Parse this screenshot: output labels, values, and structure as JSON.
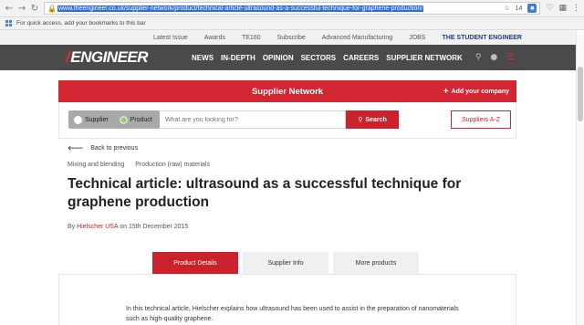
{
  "browser": {
    "url": "www.theengineer.co.uk/supplier-network/product/technical-article-ultrasound-as-a-successful-technique-for-graphene-production/",
    "ext_count": "14",
    "bookmarks_hint": "For quick access, add your bookmarks to this bar"
  },
  "site_util": {
    "links": [
      "Latest Issue",
      "Awards",
      "TE160",
      "Subscribe",
      "Advanced Manufacturing",
      "JOBS",
      "THE STUDENT ENGINEER"
    ]
  },
  "header": {
    "logo_mark": "/",
    "logo_text": "ENGINEER",
    "nav": [
      "NEWS",
      "IN-DEPTH",
      "OPINION",
      "SECTORS",
      "CAREERS",
      "SUPPLIER NETWORK"
    ]
  },
  "supplier_network": {
    "title": "Supplier Network",
    "add_company": "Add your company",
    "toggle": {
      "supplier": "Supplier",
      "product": "Product"
    },
    "search_placeholder": "What are you looking for?",
    "search_button": "Search",
    "az_button": "Suppliers A-Z"
  },
  "article": {
    "back_label": "Back to previous",
    "tags": [
      "Mixing and blending",
      "Production (raw) materials"
    ],
    "title": "Technical article: ultrasound as a successful technique for graphene production",
    "by": "By",
    "author": "Hielscher USA",
    "date_text": "on 15th December 2015",
    "tabs": [
      "Product Details",
      "Supplier Info",
      "More products"
    ],
    "intro": "In this technical article, Hielscher explains how ultrasound has been used to assist in the preparation of nanomaterials such as high-quality graphene."
  }
}
